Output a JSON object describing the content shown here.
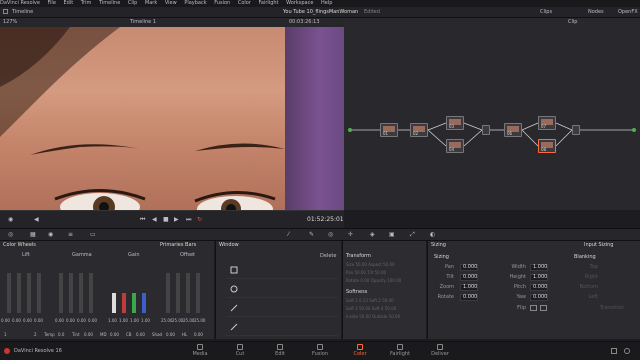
{
  "menubar": {
    "items": [
      "DaVinci Resolve",
      "File",
      "Edit",
      "Trim",
      "Timeline",
      "Clip",
      "Mark",
      "View",
      "Playback",
      "Fusion",
      "Color",
      "Fairlight",
      "Workspace",
      "Help"
    ]
  },
  "pagebar": {
    "timeline_label": "Timeline",
    "project_title": "You Tube 10_flingsManWoman",
    "edited": "Edited",
    "clips": "Clips",
    "nodes": "Nodes",
    "openfx": "OpenFX"
  },
  "viewer": {
    "zoom": "127%",
    "timeline_name": "Timeline 1",
    "timecode_top": "00:03:26:13",
    "clip_label": "Clip"
  },
  "transport": {
    "timecode": "01:52:25:01"
  },
  "wheels": {
    "panel_title": "Color Wheels",
    "mode": "Primaries Bars",
    "groups": [
      {
        "name": "Lift",
        "vals": [
          "0.00",
          "0.00",
          "0.00",
          "0.00"
        ]
      },
      {
        "name": "Gamma",
        "vals": [
          "0.00",
          "0.00",
          "0.00",
          "0.00"
        ]
      },
      {
        "name": "Gain",
        "vals": [
          "1.00",
          "1.00",
          "1.00",
          "1.00"
        ]
      },
      {
        "name": "Offset",
        "vals": [
          "25.00",
          "25.00",
          "25.00",
          "25.00"
        ]
      }
    ],
    "channels": [
      "Y",
      "R",
      "G",
      "B"
    ],
    "footer": {
      "temp": "Temp",
      "temp_val": "0.0",
      "tint": "Tint",
      "tint_val": "0.00",
      "mid": "MD",
      "mid_val": "0.00",
      "cb": "CB",
      "cb_val": "0.00",
      "shad": "Shad",
      "shad_val": "0.00",
      "hl": "HL",
      "hl_val": "0.00",
      "page": "1",
      "page2": "2"
    }
  },
  "window": {
    "title": "Window",
    "delete": "Delete"
  },
  "transform": {
    "title": "Transform",
    "softness": "Softness",
    "rows": [
      [
        "Size",
        "50.00",
        "Aspect",
        "50.00"
      ],
      [
        "Pan",
        "50.00",
        "Tilt",
        "50.00"
      ],
      [
        "Rotate",
        "0.00",
        "Opacity",
        "100.00"
      ]
    ],
    "soft_rows": [
      [
        "Soft 1",
        "0.13",
        "Soft 2",
        "50.00"
      ],
      [
        "Soft 3",
        "50.00",
        "Soft 4",
        "50.00"
      ],
      [
        "Inside",
        "50.00",
        "Outside",
        "50.00"
      ]
    ]
  },
  "sizing": {
    "title": "Sizing",
    "mode": "Input Sizing",
    "blanking": "Blanking",
    "left": [
      [
        "Pan",
        "0.000"
      ],
      [
        "Tilt",
        "0.000"
      ],
      [
        "Zoom",
        "1.000"
      ],
      [
        "Rotate",
        "0.000"
      ]
    ],
    "right": [
      [
        "Width",
        "1.000"
      ],
      [
        "Height",
        "1.000"
      ],
      [
        "Pitch",
        "0.000"
      ],
      [
        "Yaw",
        "0.000"
      ],
      [
        "Flip",
        ""
      ]
    ],
    "blank": [
      "Top",
      "Right",
      "Bottom",
      "Left",
      "Transition"
    ]
  },
  "bottom": {
    "app": "DaVinci Resolve 16",
    "pages": [
      "Media",
      "Cut",
      "Edit",
      "Fusion",
      "Color",
      "Fairlight",
      "Deliver"
    ],
    "active": "Color"
  },
  "nodes": [
    "01",
    "02",
    "03",
    "04",
    "05",
    "06",
    "07",
    "08",
    "09"
  ]
}
